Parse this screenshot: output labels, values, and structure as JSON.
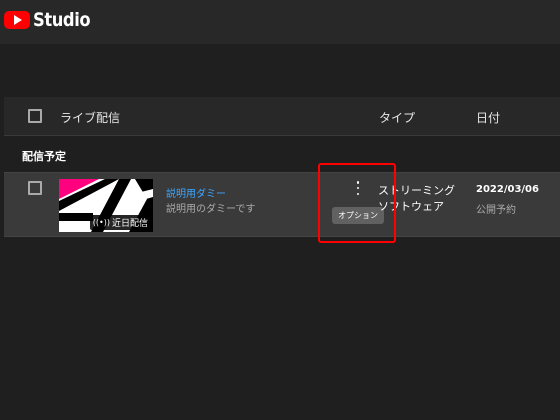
{
  "app": {
    "title": "Studio",
    "logo_icon": "youtube-logo-icon",
    "brand_color": "#ff0000"
  },
  "table": {
    "headers": {
      "live": "ライブ配信",
      "type": "タイプ",
      "date": "日付"
    },
    "section": "配信予定",
    "rows": [
      {
        "title": "説明用ダミー",
        "description": "説明用のダミーです",
        "badge": "近日配信",
        "badge_icon": "live-broadcast-icon",
        "options_icon": "more-vert-icon",
        "options_tooltip": "オプション",
        "type_line1": "ストリーミング",
        "type_line2": "ソフトウェア",
        "date": "2022/03/06",
        "status": "公開予約"
      }
    ]
  },
  "colors": {
    "accent_link": "#3ea6ff",
    "highlight": "#ff0000",
    "thumb_pink": "#ff007f"
  }
}
